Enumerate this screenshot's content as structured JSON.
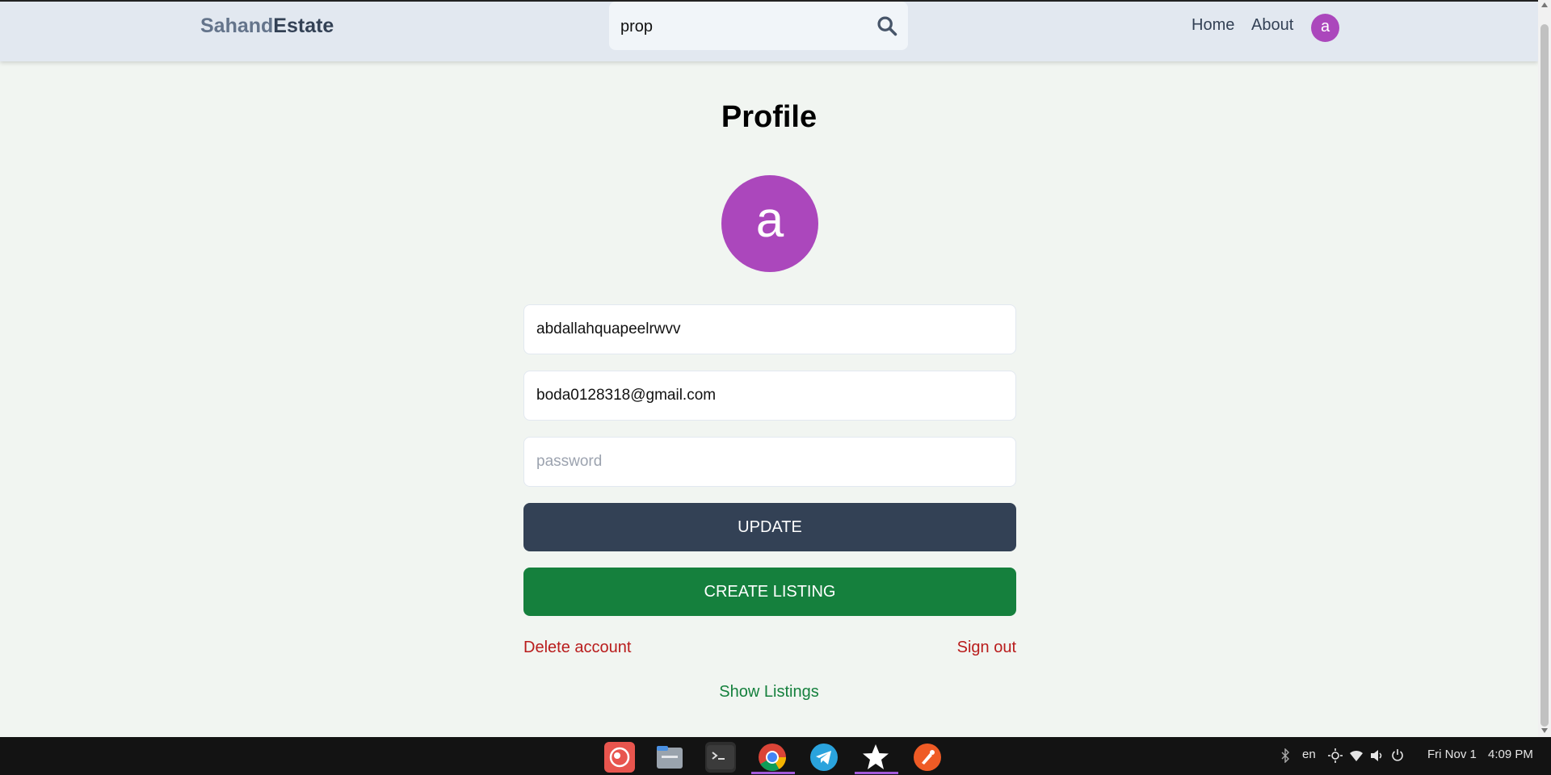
{
  "header": {
    "logo_part1": "Sahand",
    "logo_part2": "Estate",
    "search_value": "prop",
    "nav": {
      "home": "Home",
      "about": "About"
    },
    "avatar_letter": "a"
  },
  "profile": {
    "title": "Profile",
    "avatar_letter": "a",
    "username_value": "abdallahquapeelrwvv",
    "email_value": "boda0128318@gmail.com",
    "password_placeholder": "password",
    "update_label": "UPDATE",
    "create_listing_label": "CREATE LISTING",
    "delete_account_label": "Delete account",
    "sign_out_label": "Sign out",
    "show_listings_label": "Show Listings"
  },
  "colors": {
    "avatar": "#ab47bc",
    "update_button": "#334155",
    "create_button": "#15803d",
    "danger_link": "#b91c1c",
    "success_link": "#15803d"
  },
  "taskbar": {
    "apps": [
      "screen-recorder-icon",
      "files-icon",
      "terminal-icon",
      "chrome-icon",
      "telegram-icon",
      "star-app-icon",
      "postman-icon"
    ],
    "active_app": "chrome-icon",
    "language": "en",
    "date": "Fri Nov 1",
    "time": "4:09 PM"
  }
}
